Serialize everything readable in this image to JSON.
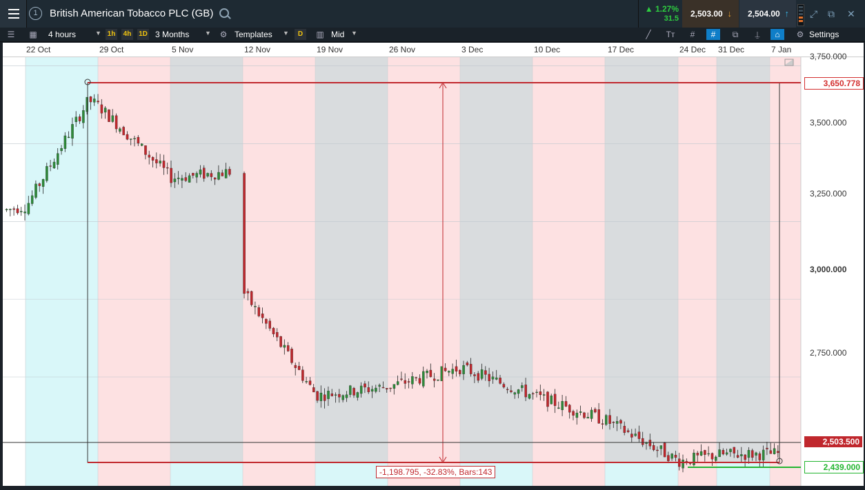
{
  "window": {
    "title": "British American Tobacco PLC (GB)",
    "circle_number": "1",
    "change_pct": "▲ 1.27%",
    "change_abs": "31.5",
    "sell_price": "2,503.00",
    "buy_price": "2,504.00",
    "icons": [
      "menu-icon",
      "search-icon",
      "expand-icon",
      "popout-icon",
      "close-icon"
    ]
  },
  "toolbar": {
    "interval": "4 hours",
    "quick_intervals": [
      "1h",
      "4h",
      "1D"
    ],
    "range": "3 Months",
    "templates": "Templates",
    "d_badge": "D",
    "price_mode": "Mid",
    "settings": "Settings"
  },
  "chart_data": {
    "type": "candlestick",
    "date_labels": [
      "22 Oct",
      "29 Oct",
      "5 Nov",
      "12 Nov",
      "19 Nov",
      "26 Nov",
      "3 Dec",
      "10 Dec",
      "17 Dec",
      "24 Dec",
      "31 Dec",
      "7 Jan"
    ],
    "y_ticks": [
      "3,750.000",
      "3,500.000",
      "3,250.000",
      "3,000.000",
      "2,750.000"
    ],
    "ylim": [
      2400,
      3780
    ],
    "high_marker": "3,650.778",
    "current_price": "2,503.500",
    "low_marker": "2,439.000",
    "measure_label": "-1,198.795, -32.83%, Bars:143",
    "approx_close_path": [
      [
        "22 Oct",
        3300
      ],
      [
        "29 Oct",
        3620
      ],
      [
        "5 Nov",
        3390
      ],
      [
        "9 Nov",
        3410
      ],
      [
        "12 Nov",
        3020
      ],
      [
        "19 Nov",
        2690
      ],
      [
        "26 Nov",
        2720
      ],
      [
        "3 Dec",
        2780
      ],
      [
        "10 Dec",
        2690
      ],
      [
        "17 Dec",
        2610
      ],
      [
        "24 Dec",
        2480
      ],
      [
        "31 Dec",
        2500
      ],
      [
        "7 Jan",
        2503.5
      ]
    ]
  },
  "colors": {
    "up": "#2e8b3a",
    "down": "#c0272d",
    "pink_zone": "#fde1e2",
    "grey_zone": "#d9dcde",
    "cyan_zone": "#d9f7f9",
    "measure_red": "#d32f2f",
    "low_green": "#22b52f"
  }
}
